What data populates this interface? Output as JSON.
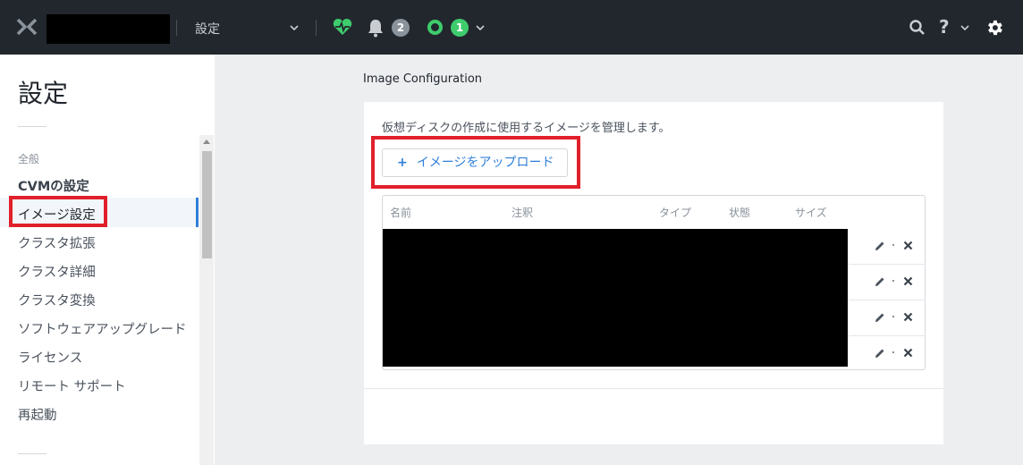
{
  "header": {
    "menu_label": "設定",
    "alerts_count": "2",
    "tasks_count": "1",
    "help_label": "?"
  },
  "sidebar": {
    "title": "設定",
    "section": "全般",
    "items": [
      {
        "label": "CVMの設定"
      },
      {
        "label": "イメージ設定"
      },
      {
        "label": "クラスタ拡張"
      },
      {
        "label": "クラスタ詳細"
      },
      {
        "label": "クラスタ変換"
      },
      {
        "label": "ソフトウェアアップグレード"
      },
      {
        "label": "ライセンス"
      },
      {
        "label": "リモート サポート"
      },
      {
        "label": "再起動"
      }
    ]
  },
  "main": {
    "heading": "Image Configuration",
    "description": "仮想ディスクの作成に使用するイメージを管理します。",
    "upload_button": "イメージをアップロード",
    "upload_icon": "+",
    "table": {
      "columns": [
        "名前",
        "注釈",
        "タイプ",
        "状態",
        "サイズ"
      ]
    }
  },
  "colors": {
    "topbar": "#22272e",
    "accent": "#2f7fd9",
    "health": "#3ecc6d",
    "highlight": "#e0202a"
  },
  "icons": [
    "nutanix-logo-icon",
    "chevron-down-icon",
    "health-heart-icon",
    "bell-icon",
    "task-ring-icon",
    "search-icon",
    "help-icon",
    "gear-icon",
    "pencil-icon",
    "close-icon"
  ]
}
